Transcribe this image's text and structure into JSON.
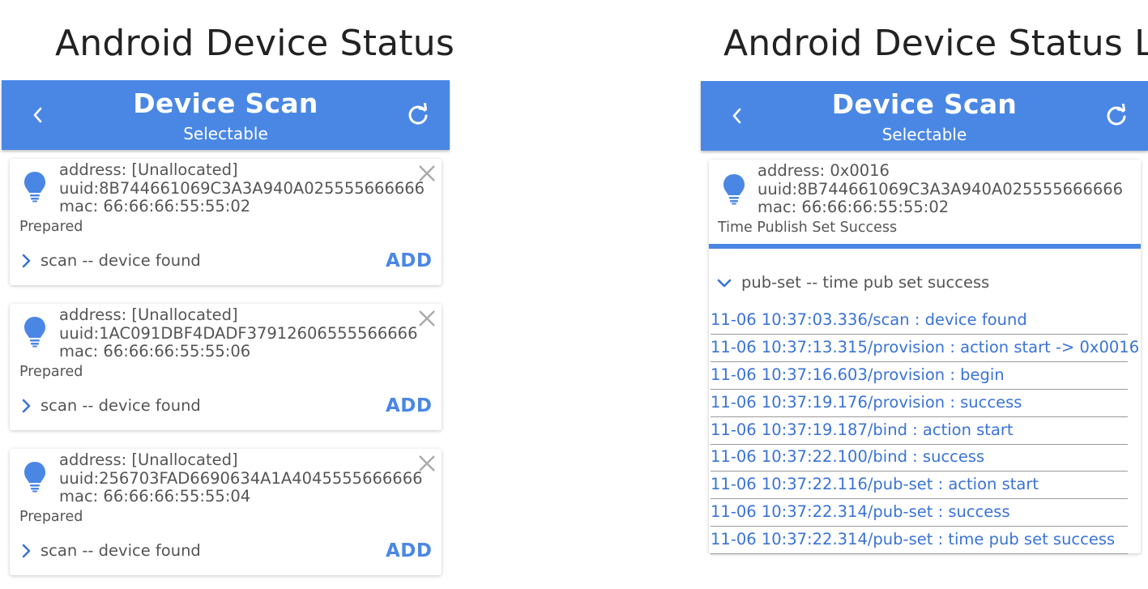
{
  "left_panel": {
    "heading": "Android Device Status",
    "appbar": {
      "title": "Device Scan",
      "subtitle": "Selectable"
    },
    "devices": [
      {
        "address": "address: [Unallocated]",
        "uuid": "uuid:8B744661069C3A3A940A025555666666",
        "mac": "mac: 66:66:66:55:55:02",
        "status": "Prepared",
        "log": "scan -- device found",
        "action": "ADD"
      },
      {
        "address": "address: [Unallocated]",
        "uuid": "uuid:1AC091DBF4DADF37912606555566666",
        "mac": "mac: 66:66:66:55:55:06",
        "status": "Prepared",
        "log": "scan -- device found",
        "action": "ADD"
      },
      {
        "address": "address: [Unallocated]",
        "uuid": "uuid:256703FAD6690634A1A4045555666666",
        "mac": "mac: 66:66:66:55:55:04",
        "status": "Prepared",
        "log": "scan -- device found",
        "action": "ADD"
      }
    ]
  },
  "right_panel": {
    "heading": "Android Device Status List",
    "appbar": {
      "title": "Device Scan",
      "subtitle": "Selectable"
    },
    "device": {
      "address": "address: 0x0016",
      "uuid": "uuid:8B744661069C3A3A940A025555666666",
      "mac": "mac: 66:66:66:55:55:02",
      "status": "Time Publish Set Success",
      "progress": 1.0,
      "log": "pub-set -- time pub set success"
    },
    "events": [
      "11-06 10:37:03.336/scan : device found",
      "11-06 10:37:13.315/provision : action start -> 0x0016",
      "11-06 10:37:16.603/provision : begin",
      "11-06 10:37:19.176/provision : success",
      "11-06 10:37:19.187/bind : action start",
      "11-06 10:37:22.100/bind : success",
      "11-06 10:37:22.116/pub-set : action start",
      "11-06 10:37:22.314/pub-set : success",
      "11-06 10:37:22.314/pub-set : time pub set success"
    ]
  },
  "colors": {
    "accent": "#4a87e5",
    "link": "#3a73d6",
    "text": "#555555"
  },
  "icons": [
    "back-arrow-icon",
    "refresh-icon",
    "bulb-icon",
    "close-icon",
    "chevron-right-icon",
    "chevron-down-icon"
  ]
}
